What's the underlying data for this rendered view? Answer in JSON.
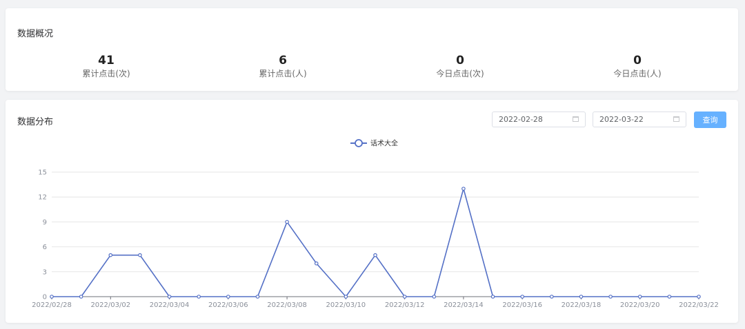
{
  "overview": {
    "title": "数据概况",
    "stats": [
      {
        "value": "41",
        "label": "累计点击(次)"
      },
      {
        "value": "6",
        "label": "累计点击(人)"
      },
      {
        "value": "0",
        "label": "今日点击(次)"
      },
      {
        "value": "0",
        "label": "今日点击(人)"
      }
    ]
  },
  "distribution": {
    "title": "数据分布",
    "start_date": "2022-02-28",
    "end_date": "2022-03-22",
    "search_label": "查询"
  },
  "colors": {
    "series": "#5470c6",
    "button": "#66b1ff",
    "grid": "#e6e6e6"
  },
  "chart_data": {
    "type": "line",
    "legend_position": "top-center",
    "grid": true,
    "x": [
      "2022/02/28",
      "2022/03/01",
      "2022/03/02",
      "2022/03/03",
      "2022/03/04",
      "2022/03/05",
      "2022/03/06",
      "2022/03/07",
      "2022/03/08",
      "2022/03/09",
      "2022/03/10",
      "2022/03/11",
      "2022/03/12",
      "2022/03/13",
      "2022/03/14",
      "2022/03/15",
      "2022/03/16",
      "2022/03/17",
      "2022/03/18",
      "2022/03/19",
      "2022/03/20",
      "2022/03/21",
      "2022/03/22"
    ],
    "x_tick_labels": [
      "2022/02/28",
      "2022/03/02",
      "2022/03/04",
      "2022/03/06",
      "2022/03/08",
      "2022/03/10",
      "2022/03/12",
      "2022/03/14",
      "2022/03/16",
      "2022/03/18",
      "2022/03/20",
      "2022/03/22"
    ],
    "y_ticks": [
      0,
      3,
      6,
      9,
      12,
      15
    ],
    "ylim": [
      0,
      15
    ],
    "series": [
      {
        "name": "话术大全",
        "values": [
          0,
          0,
          5,
          5,
          0,
          0,
          0,
          0,
          9,
          4,
          0,
          5,
          0,
          0,
          13,
          0,
          0,
          0,
          0,
          0,
          0,
          0,
          0
        ]
      }
    ]
  }
}
